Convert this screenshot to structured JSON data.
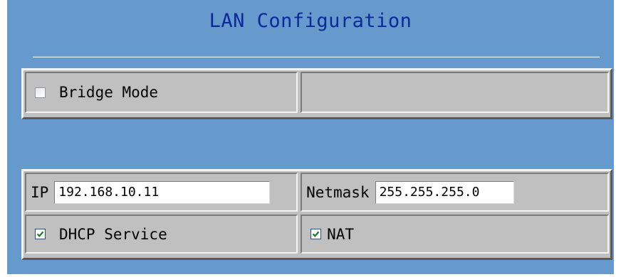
{
  "title": "LAN Configuration",
  "bridge_mode": {
    "label": "Bridge Mode",
    "checked": false
  },
  "ip": {
    "label": "IP",
    "value": "192.168.10.11"
  },
  "netmask": {
    "label": "Netmask",
    "value": "255.255.255.0"
  },
  "dhcp_service": {
    "label": "DHCP Service",
    "checked": true
  },
  "nat": {
    "label": "NAT",
    "checked": true
  },
  "colors": {
    "panel_background": "#6699cc",
    "title_text": "#0a2a9a",
    "table_background": "#c0c0c0"
  },
  "icons": {
    "checked": "checkmark-icon"
  }
}
